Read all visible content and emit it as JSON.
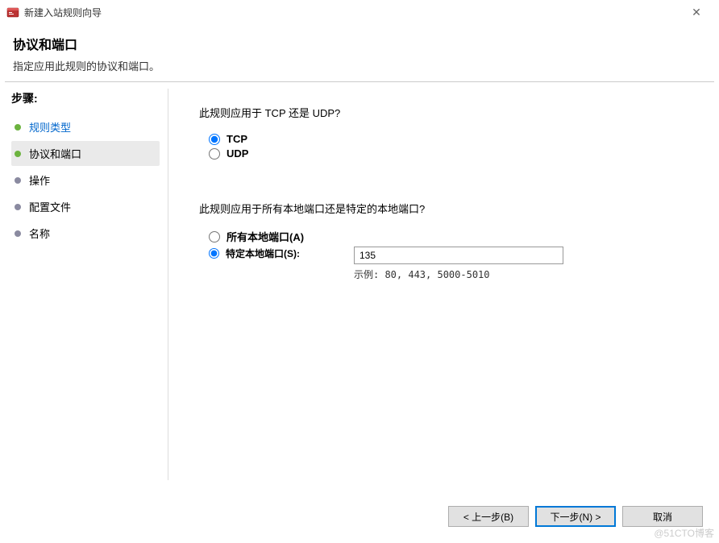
{
  "window": {
    "title": "新建入站规则向导",
    "close": "✕"
  },
  "header": {
    "title": "协议和端口",
    "subtitle": "指定应用此规则的协议和端口。"
  },
  "sidebar": {
    "stepsLabel": "步骤:",
    "items": [
      {
        "label": "规则类型",
        "active": true
      },
      {
        "label": "协议和端口",
        "current": true
      },
      {
        "label": "操作"
      },
      {
        "label": "配置文件"
      },
      {
        "label": "名称"
      }
    ]
  },
  "main": {
    "q1": "此规则应用于 TCP 还是 UDP?",
    "protoTcp": "TCP",
    "protoUdp": "UDP",
    "q2": "此规则应用于所有本地端口还是特定的本地端口?",
    "allPorts": "所有本地端口(A)",
    "specificPorts": "特定本地端口(S):",
    "portValue": "135",
    "portHint": "示例: 80, 443, 5000-5010"
  },
  "footer": {
    "back": "< 上一步(B)",
    "next": "下一步(N) >",
    "cancel": "取消"
  },
  "watermark": "@51CTO博客"
}
